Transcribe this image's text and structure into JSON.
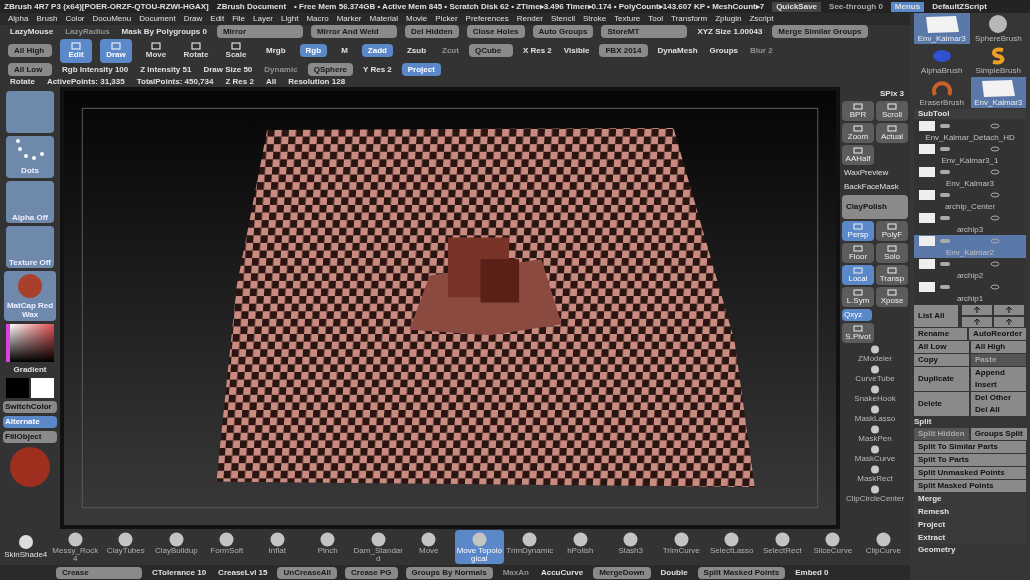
{
  "title_bar": {
    "title": "ZBrush 4R7 P3 (x64)[POER-ORZF-QTOU-RZWI-HGAX]",
    "document": "ZBrush Document",
    "stats": "• Free Mem 56.374GB • Active Mem 845 • Scratch Disk 62 • ZTime▸3.496 Timer▸0.174 • PolyCount▸143.607 KP • MeshCount▸7",
    "quicksave": "QuickSave",
    "see_through": "See-through 0",
    "menus": {
      "label": "Menus",
      "selected": true
    },
    "script": "DefaultZScript"
  },
  "menu_bar": [
    "Alpha",
    "Brush",
    "Color",
    "DocuMenu",
    "Document",
    "Draw",
    "Edit",
    "File",
    "Layer",
    "Light",
    "Macro",
    "Marker",
    "Material",
    "Movie",
    "Picker",
    "Preferences",
    "Render",
    "Stencil",
    "Stroke",
    "Texture",
    "Tool",
    "Transform",
    "Zplugin",
    "Zscript"
  ],
  "top_shelf": [
    [
      {
        "label": "LazyMouse",
        "kind": "text"
      },
      {
        "label": "LazyRadius",
        "kind": "dim"
      },
      {
        "label": "Mask By Polygroups 0",
        "kind": "text"
      },
      {
        "label": "Mirror",
        "kind": "wide"
      },
      {
        "label": "Mirror And Weld",
        "kind": "wide"
      },
      {
        "label": "Del Hidden",
        "kind": "button"
      },
      {
        "label": "Close Holes",
        "kind": "button"
      },
      {
        "label": "Auto Groups",
        "kind": "button"
      },
      {
        "label": "StoreMT",
        "kind": "wide"
      },
      {
        "label": "XYZ Size 1.00043",
        "kind": "text"
      },
      {
        "label": "Merge Similar Groups",
        "kind": "wide"
      }
    ],
    [
      {
        "label": "All High",
        "kind": "button"
      },
      {
        "label": "Edit",
        "kind": "tool",
        "selected": true
      },
      {
        "label": "Draw",
        "kind": "tool",
        "selected": true
      },
      {
        "label": "Move",
        "kind": "tool",
        "selected": false
      },
      {
        "label": "Rotate",
        "kind": "tool",
        "selected": false
      },
      {
        "label": "Scale",
        "kind": "tool",
        "selected": false
      },
      {
        "label": "Mrgb",
        "kind": "toggle",
        "selected": false
      },
      {
        "label": "Rgb",
        "kind": "toggle",
        "selected": true
      },
      {
        "label": "M",
        "kind": "toggle",
        "selected": false
      },
      {
        "label": "Zadd",
        "kind": "toggle",
        "selected": true
      },
      {
        "label": "Zsub",
        "kind": "toggle",
        "selected": false
      },
      {
        "label": "Zcut",
        "kind": "dim"
      },
      {
        "label": "QCube",
        "kind": "button"
      },
      {
        "label": "X Res 2",
        "kind": "text"
      },
      {
        "label": "Visible",
        "kind": "text"
      },
      {
        "label": "FBX 2014",
        "kind": "button"
      },
      {
        "label": "DynaMesh",
        "kind": "text"
      },
      {
        "label": "Groups",
        "kind": "text"
      },
      {
        "label": "Blur 2",
        "kind": "dim"
      }
    ],
    [
      {
        "label": "All Low",
        "kind": "button"
      },
      {
        "label": "Rgb Intensity 100",
        "kind": "text"
      },
      {
        "label": "Z Intensity 51",
        "kind": "text"
      },
      {
        "label": "Draw Size 50",
        "kind": "text"
      },
      {
        "label": "Dynamic",
        "kind": "dim"
      },
      {
        "label": "QSphere",
        "kind": "button"
      },
      {
        "label": "Y Res 2",
        "kind": "text"
      },
      {
        "label": "Project",
        "kind": "toggle",
        "selected": true
      }
    ],
    [
      {
        "label": "Rotate",
        "kind": "text"
      },
      {
        "label": "ActivePoints: 31,335",
        "kind": "text"
      },
      {
        "label": "TotalPoints: 450,734",
        "kind": "text"
      },
      {
        "label": "Z Res 2",
        "kind": "text"
      },
      {
        "label": "All",
        "kind": "text"
      },
      {
        "label": "Resolution 128",
        "kind": "text"
      }
    ]
  ],
  "left_shelf": [
    {
      "kind": "thumb"
    },
    {
      "label": "Dots",
      "kind": "stroke"
    },
    {
      "label": "Alpha Off",
      "kind": "thumb"
    },
    {
      "label": "Texture Off",
      "kind": "thumb"
    },
    {
      "label": "MatCap Red Wax",
      "kind": "sphere"
    },
    {
      "kind": "picker"
    },
    {
      "label": "Gradient",
      "kind": "text"
    },
    {
      "kind": "swatches"
    },
    {
      "label": "SwitchColor",
      "kind": "button",
      "selected": false
    },
    {
      "label": "Alternate",
      "kind": "button",
      "selected": true
    },
    {
      "label": "FillObject",
      "kind": "button",
      "selected": false
    },
    {
      "kind": "bigsphere"
    }
  ],
  "right_shelf": [
    {
      "label": "SPix 3",
      "kind": "text"
    },
    {
      "label": "BPR",
      "kind": "icon",
      "selected": false
    },
    {
      "label": "Scroll",
      "kind": "icon",
      "selected": false
    },
    {
      "label": "Zoom",
      "kind": "icon",
      "selected": false
    },
    {
      "label": "Actual",
      "kind": "icon",
      "selected": false
    },
    {
      "label": "AAHalf",
      "kind": "icon",
      "selected": false
    },
    {
      "label": "WaxPreview",
      "kind": "wide"
    },
    {
      "label": "BackFaceMask",
      "kind": "wide"
    },
    {
      "label": "ClayPolish",
      "kind": "big"
    },
    {
      "label": "Persp",
      "kind": "icon",
      "selected": true
    },
    {
      "label": "PolyF",
      "kind": "icon",
      "selected": false
    },
    {
      "label": "Floor",
      "kind": "icon",
      "selected": false
    },
    {
      "label": "Solo",
      "kind": "icon",
      "selected": false
    },
    {
      "label": "Local",
      "kind": "icon",
      "selected": true
    },
    {
      "label": "Transp",
      "kind": "icon",
      "selected": false
    },
    {
      "label": "L.Sym",
      "kind": "icon",
      "selected": false
    },
    {
      "label": "Xpose",
      "kind": "icon",
      "selected": false
    },
    {
      "label": "Qxyz",
      "kind": "wide",
      "selected": true
    },
    {
      "label": "S.Pivot",
      "kind": "icon",
      "selected": false
    },
    {
      "label": "ZModeler",
      "kind": "brush"
    },
    {
      "label": "CurveTube",
      "kind": "brush"
    },
    {
      "label": "SnakeHook",
      "kind": "brush"
    },
    {
      "label": "MaskLasso",
      "kind": "brush"
    },
    {
      "label": "MaskPen",
      "kind": "brush"
    },
    {
      "label": "MaskCurve",
      "kind": "brush"
    },
    {
      "label": "MaskRect",
      "kind": "brush"
    },
    {
      "label": "ClipCircleCenter",
      "kind": "brush"
    }
  ],
  "brush_shelf": {
    "left_label": "SkinShade4",
    "brushes": [
      {
        "label": "Messy_Rock4",
        "selected": false
      },
      {
        "label": "ClayTubes",
        "selected": false
      },
      {
        "label": "ClayBuildup",
        "selected": false
      },
      {
        "label": "FormSoft",
        "selected": false
      },
      {
        "label": "Inflat",
        "selected": false
      },
      {
        "label": "Pinch",
        "selected": false
      },
      {
        "label": "Dam_Standard",
        "selected": false
      },
      {
        "label": "Move",
        "selected": false
      },
      {
        "label": "Move Topological",
        "selected": true
      },
      {
        "label": "TrimDynamic",
        "selected": false
      },
      {
        "label": "hPolish",
        "selected": false
      },
      {
        "label": "Slash3",
        "selected": false
      },
      {
        "label": "TrimCurve",
        "selected": false
      },
      {
        "label": "SelectLasso",
        "selected": false
      },
      {
        "label": "SelectRect",
        "selected": false
      },
      {
        "label": "SliceCurve",
        "selected": false
      },
      {
        "label": "ClipCurve",
        "selected": false
      }
    ]
  },
  "bottom_bar": [
    {
      "label": "Crease",
      "kind": "wide"
    },
    {
      "label": "CTolerance 10",
      "kind": "text"
    },
    {
      "label": "CreaseLvl 15",
      "kind": "text"
    },
    {
      "label": "UnCreaseAll",
      "kind": "button"
    },
    {
      "label": "Crease PG",
      "kind": "button"
    },
    {
      "label": "Groups By Normals",
      "kind": "button"
    },
    {
      "label": "MaxAn",
      "kind": "dim"
    },
    {
      "label": "AccuCurve",
      "kind": "text"
    },
    {
      "label": "MergeDown",
      "kind": "button"
    },
    {
      "label": "Double",
      "kind": "text"
    },
    {
      "label": "Split Masked Points",
      "kind": "wide"
    },
    {
      "label": "Embed 0",
      "kind": "text"
    }
  ],
  "right_panel": {
    "brushes": [
      {
        "label": "Env_Kalmar3",
        "kind": "mesh",
        "selected": true
      },
      {
        "label": "SphereBrush",
        "kind": "sphere",
        "selected": false
      },
      {
        "label": "AlphaBrush",
        "kind": "blue",
        "selected": false
      },
      {
        "label": "SimpleBrush",
        "kind": "s",
        "selected": false
      },
      {
        "label": "EraserBrush",
        "kind": "ring",
        "selected": false
      },
      {
        "label": "Env_Kalmar3",
        "kind": "mesh",
        "selected": true
      }
    ],
    "subtool": {
      "title": "SubTool",
      "items": [
        {
          "name": "Env_Kalmar_Detach_HD",
          "selected": false
        },
        {
          "name": "Env_Kalmar3_1",
          "selected": false
        },
        {
          "name": "Env_Kalmar3",
          "selected": false
        },
        {
          "name": "archip_Center",
          "selected": false
        },
        {
          "name": "archip3",
          "selected": false
        },
        {
          "name": "Env_Kalmar2",
          "selected": true
        },
        {
          "name": "archip2",
          "selected": false
        },
        {
          "name": "archip1",
          "selected": false
        }
      ]
    },
    "list_all": "List All",
    "button_rows": [
      {
        "left": {
          "label": "Rename",
          "kind": "button"
        },
        "right": [
          {
            "label": "AutoReorder",
            "kind": "button"
          }
        ]
      },
      {
        "left": {
          "label": "All Low",
          "kind": "button"
        },
        "right": [
          {
            "label": "All High",
            "kind": "button"
          }
        ]
      },
      {
        "left": {
          "label": "Copy",
          "kind": "button"
        },
        "right": [
          {
            "label": "Paste",
            "kind": "dim"
          }
        ]
      },
      {
        "left": {
          "label": "Duplicate",
          "kind": "button"
        },
        "right": [
          {
            "label": "Append",
            "kind": "button"
          },
          {
            "label": "Insert",
            "kind": "button"
          }
        ]
      },
      {
        "left": {
          "label": "Delete",
          "kind": "button"
        },
        "right": [
          {
            "label": "Del Other",
            "kind": "button"
          },
          {
            "label": "Del All",
            "kind": "button"
          }
        ]
      }
    ],
    "split": {
      "title": "Split",
      "top": [
        {
          "label": "Split Hidden",
          "kind": "dim"
        },
        {
          "label": "Groups Split",
          "kind": "button"
        }
      ],
      "items": [
        "Split To Similar Parts",
        "Split To Parts",
        "Split Unmasked Points",
        "Split Masked Points"
      ]
    },
    "sections": [
      "Merge",
      "Remesh",
      "Project",
      "Extract"
    ],
    "footer": "Geometry"
  }
}
